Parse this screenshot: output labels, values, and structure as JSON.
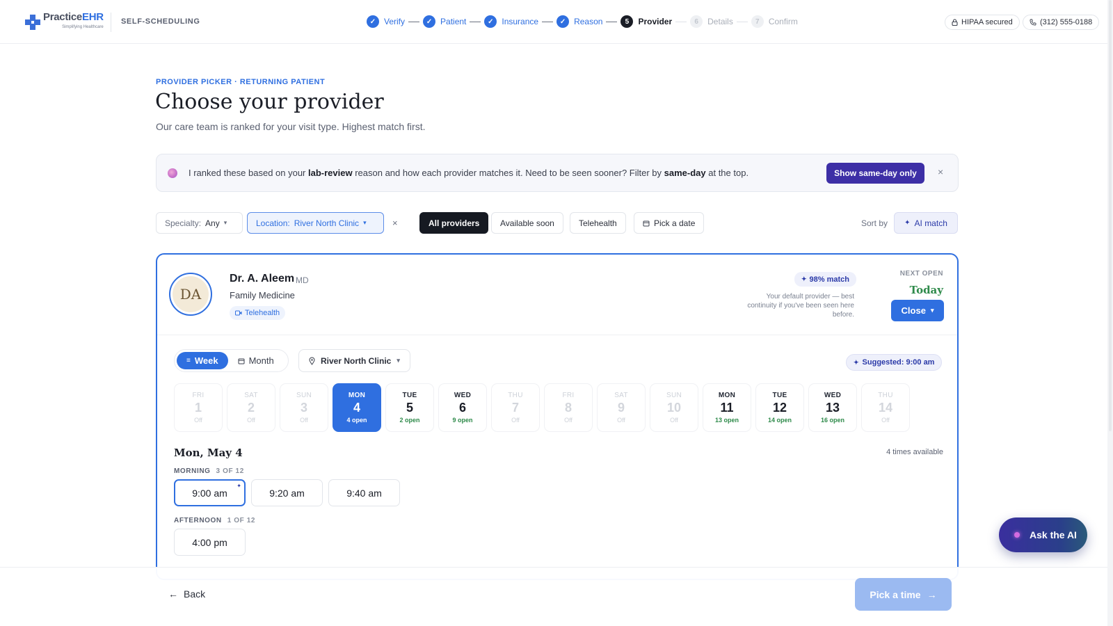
{
  "brand": {
    "name_a": "Practice",
    "name_b": "EHR",
    "tagline": "Simplifying Healthcare",
    "section": "SELF-SCHEDULING"
  },
  "steps": [
    {
      "num": "1",
      "label": "Verify",
      "state": "done"
    },
    {
      "num": "2",
      "label": "Patient",
      "state": "done"
    },
    {
      "num": "3",
      "label": "Insurance",
      "state": "done"
    },
    {
      "num": "4",
      "label": "Reason",
      "state": "done"
    },
    {
      "num": "5",
      "label": "Provider",
      "state": "current"
    },
    {
      "num": "6",
      "label": "Details",
      "state": "todo"
    },
    {
      "num": "7",
      "label": "Confirm",
      "state": "todo"
    }
  ],
  "topbar": {
    "hipaa": "HIPAA secured",
    "phone": "(312) 555-0188"
  },
  "header": {
    "eyebrow": "PROVIDER PICKER · RETURNING PATIENT",
    "title": "Choose your provider",
    "subtitle": "Our care team is ranked for your visit type. Highest match first."
  },
  "banner": {
    "t1": "I ranked these based on your ",
    "b1": "lab-review",
    "t2": " reason and how each provider matches it. Need to be seen sooner? Filter by ",
    "b2": "same-day",
    "t3": " at the top.",
    "button": "Show same-day only",
    "close": "×"
  },
  "filters": {
    "specialty_key": "Specialty:",
    "specialty_value": "Any",
    "location_key": "Location:",
    "location_value": "River North Clinic",
    "clear": "×",
    "chips": [
      "All providers",
      "Available soon",
      "Telehealth",
      "Pick a date"
    ],
    "sort_label": "Sort by",
    "sort_value": "AI match"
  },
  "provider": {
    "initials": "DA",
    "name": "Dr. A. Aleem",
    "credential": "MD",
    "specialty": "Family Medicine",
    "telehealth": "Telehealth",
    "match": "98% match",
    "note": "Your default provider — best continuity if you've been seen here before.",
    "next_open_label": "NEXT OPEN",
    "next_open_value": "Today",
    "close_button": "Close"
  },
  "calendar": {
    "view_week": "Week",
    "view_month": "Month",
    "clinic": "River North Clinic",
    "suggested": "Suggested: 9:00 am",
    "days": [
      {
        "dow": "FRI",
        "num": "1",
        "status": "Off",
        "state": "off"
      },
      {
        "dow": "SAT",
        "num": "2",
        "status": "Off",
        "state": "off"
      },
      {
        "dow": "SUN",
        "num": "3",
        "status": "Off",
        "state": "off"
      },
      {
        "dow": "MON",
        "num": "4",
        "status": "4 open",
        "state": "sel"
      },
      {
        "dow": "TUE",
        "num": "5",
        "status": "2 open",
        "state": "open"
      },
      {
        "dow": "WED",
        "num": "6",
        "status": "9 open",
        "state": "open"
      },
      {
        "dow": "THU",
        "num": "7",
        "status": "Off",
        "state": "off"
      },
      {
        "dow": "FRI",
        "num": "8",
        "status": "Off",
        "state": "off"
      },
      {
        "dow": "SAT",
        "num": "9",
        "status": "Off",
        "state": "off"
      },
      {
        "dow": "SUN",
        "num": "10",
        "status": "Off",
        "state": "off"
      },
      {
        "dow": "MON",
        "num": "11",
        "status": "13 open",
        "state": "open"
      },
      {
        "dow": "TUE",
        "num": "12",
        "status": "14 open",
        "state": "open"
      },
      {
        "dow": "WED",
        "num": "13",
        "status": "16 open",
        "state": "open"
      },
      {
        "dow": "THU",
        "num": "14",
        "status": "Off",
        "state": "off"
      }
    ],
    "selected_date": "Mon, May 4",
    "times_available": "4 times available",
    "morning_label": "MORNING",
    "morning_count": "3 OF 12",
    "morning_slots": [
      "9:00 am",
      "9:20 am",
      "9:40 am"
    ],
    "afternoon_label": "AFTERNOON",
    "afternoon_count": "1 OF 12",
    "afternoon_slots": [
      "4:00 pm"
    ]
  },
  "footer": {
    "back": "Back",
    "next": "Pick a time"
  },
  "assistant": {
    "label": "Ask the AI"
  },
  "colors": {
    "accent": "#2f6fe0",
    "ai": "#3d2fa6",
    "open": "#2e8a4a"
  }
}
